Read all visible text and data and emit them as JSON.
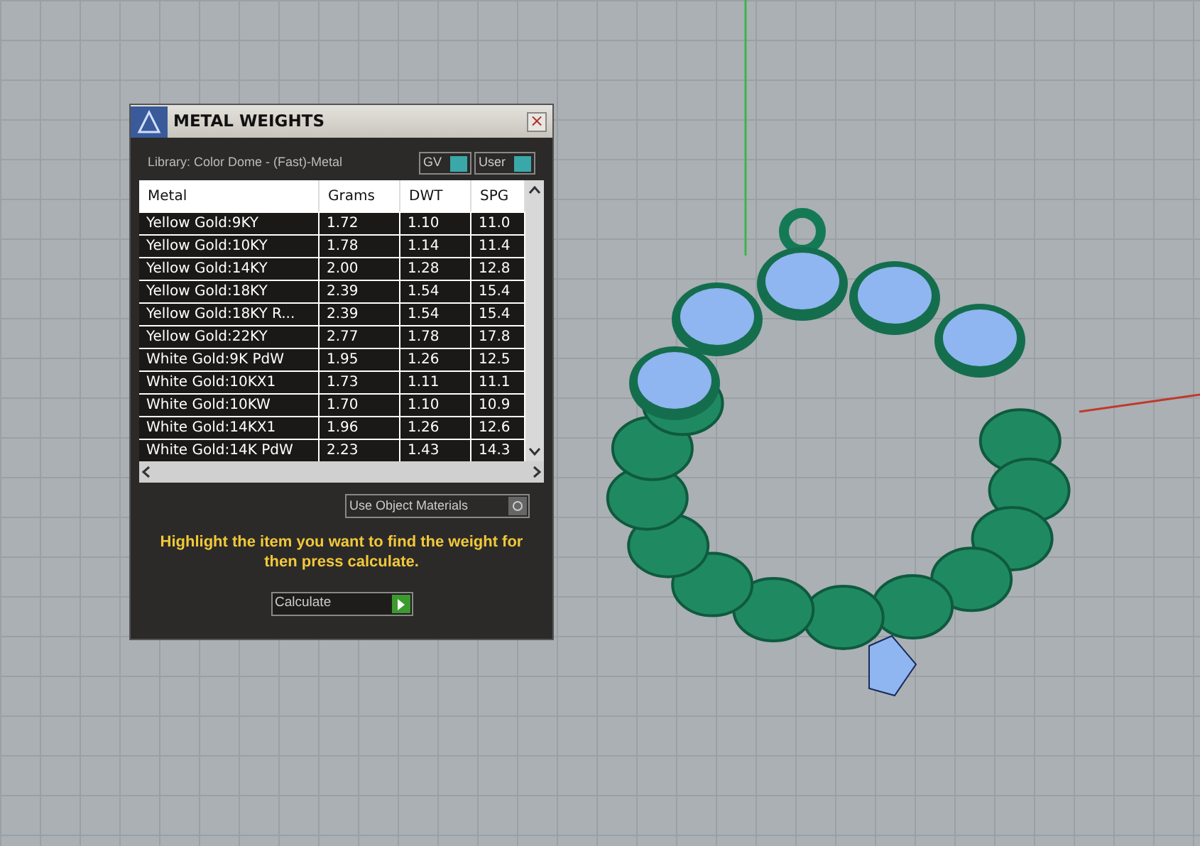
{
  "dialog": {
    "title": "METAL WEIGHTS",
    "close": "×",
    "library": "Library: Color Dome - (Fast)-Metal",
    "toggles": [
      "GV",
      "User"
    ],
    "table": {
      "columns": [
        "Metal",
        "Grams",
        "DWT",
        "SPG"
      ],
      "rows": [
        [
          "Yellow Gold:9KY",
          "1.72",
          "1.10",
          "11.0"
        ],
        [
          "Yellow Gold:10KY",
          "1.78",
          "1.14",
          "11.4"
        ],
        [
          "Yellow Gold:14KY",
          "2.00",
          "1.28",
          "12.8"
        ],
        [
          "Yellow Gold:18KY",
          "2.39",
          "1.54",
          "15.4"
        ],
        [
          "Yellow Gold:18KY R...",
          "2.39",
          "1.54",
          "15.4"
        ],
        [
          "Yellow Gold:22KY",
          "2.77",
          "1.78",
          "17.8"
        ],
        [
          "White Gold:9K PdW",
          "1.95",
          "1.26",
          "12.5"
        ],
        [
          "White Gold:10KX1",
          "1.73",
          "1.11",
          "11.1"
        ],
        [
          "White Gold:10KW",
          "1.70",
          "1.10",
          "10.9"
        ],
        [
          "White Gold:14KX1",
          "1.96",
          "1.26",
          "12.6"
        ],
        [
          "White Gold:14K PdW",
          "2.23",
          "1.43",
          "14.3"
        ]
      ]
    },
    "use_object_materials": "Use Object Materials",
    "hint": "Highlight the item you want to find the weight for then press calculate.",
    "calculate": "Calculate"
  }
}
